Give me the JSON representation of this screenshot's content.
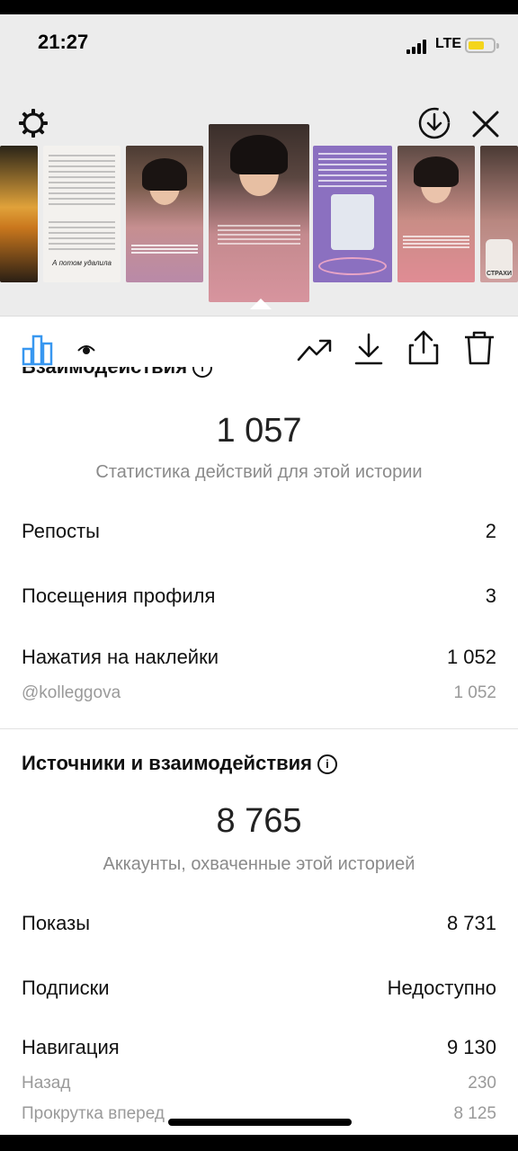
{
  "status": {
    "time": "21:27",
    "network": "LTE",
    "battery_level": 0.65,
    "battery_color": "#f4d51c"
  },
  "header": {
    "icons": [
      "gear-icon",
      "download-circle-icon",
      "close-icon"
    ],
    "thumbnail_captions": {
      "t1": "А потом удалила",
      "t8": "СТРАХИ"
    },
    "selected_thumbnail_index": 4
  },
  "toolbar": {
    "icons": [
      "bar-chart-icon",
      "eye-icon",
      "trend-icon",
      "download-icon",
      "share-icon",
      "trash-icon"
    ],
    "accent_color": "#3897f0"
  },
  "interactions": {
    "title": "Взаимодействия",
    "total": "1 057",
    "caption": "Статистика действий для этой истории",
    "rows": [
      {
        "label": "Репосты",
        "value": "2"
      },
      {
        "label": "Посещения профиля",
        "value": "3"
      },
      {
        "label": "Нажатия на наклейки",
        "value": "1 052"
      }
    ],
    "sub_rows": [
      {
        "label": "@kolleggova",
        "value": "1 052"
      }
    ]
  },
  "sources": {
    "title": "Источники и взаимодействия",
    "total": "8 765",
    "caption": "Аккаунты, охваченные этой историей",
    "rows": [
      {
        "label": "Показы",
        "value": "8 731"
      },
      {
        "label": "Подписки",
        "value": "Недоступно"
      },
      {
        "label": "Навигация",
        "value": "9 130"
      }
    ],
    "sub_rows": [
      {
        "label": "Назад",
        "value": "230"
      },
      {
        "label": "Прокрутка вперед",
        "value": "8 125"
      }
    ]
  }
}
